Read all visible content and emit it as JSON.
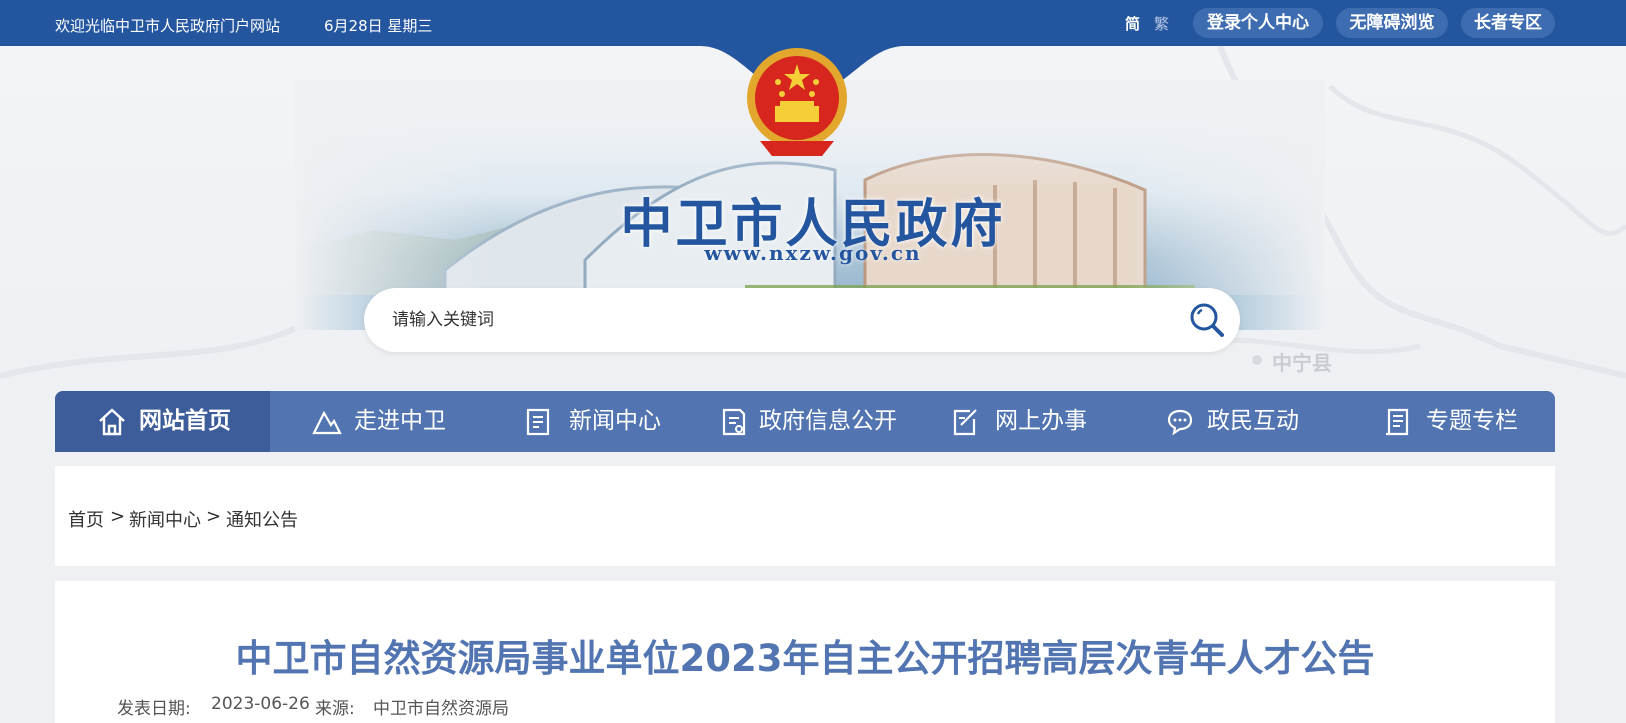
{
  "topbar": {
    "welcome": "欢迎光临中卫市人民政府门户网站",
    "date": "6月28日 星期三",
    "simplified": "简",
    "traditional": "繁",
    "login": "登录个人中心",
    "accessible": "无障碍浏览",
    "elder": "长者专区"
  },
  "banner": {
    "title": "中卫市人民政府",
    "url": "www.nxzw.gov.cn",
    "county_label": "中宁县"
  },
  "search": {
    "placeholder": "请输入关键词"
  },
  "nav": {
    "items": [
      {
        "label": "网站首页",
        "icon": "home-icon"
      },
      {
        "label": "走进中卫",
        "icon": "mountain-icon"
      },
      {
        "label": "新闻中心",
        "icon": "news-icon"
      },
      {
        "label": "政府信息公开",
        "icon": "document-icon"
      },
      {
        "label": "网上办事",
        "icon": "edit-icon"
      },
      {
        "label": "政民互动",
        "icon": "chat-icon"
      },
      {
        "label": "专题专栏",
        "icon": "column-icon"
      }
    ]
  },
  "breadcrumb": {
    "items": [
      "首页",
      "新闻中心",
      "通知公告"
    ],
    "separator": ">"
  },
  "article": {
    "title": "中卫市自然资源局事业单位2023年自主公开招聘高层次青年人才公告",
    "date_label": "发表日期:",
    "date": "2023-06-26",
    "source_label": "来源:",
    "source": "中卫市自然资源局"
  },
  "colors": {
    "topbar": "#2456a0",
    "nav": "#5275b2",
    "nav_active": "#3c5d9a",
    "title": "#5275b2"
  }
}
